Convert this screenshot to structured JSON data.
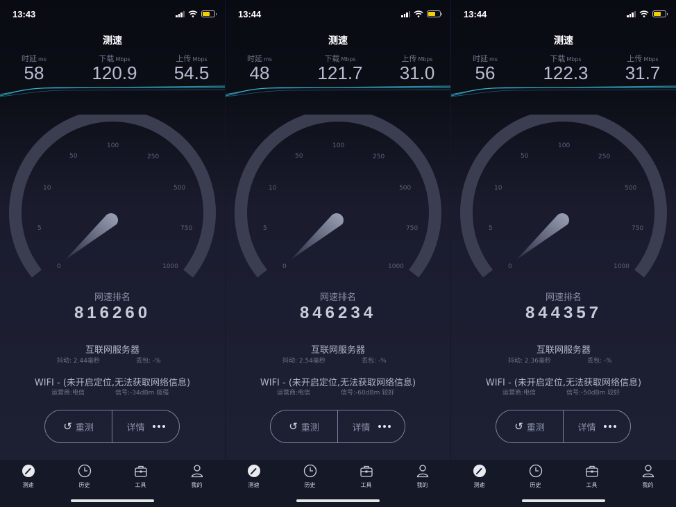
{
  "title": "测速",
  "labels": {
    "ping": "时延",
    "ping_unit": "ms",
    "download": "下载",
    "download_unit": "Mbps",
    "upload": "上传",
    "upload_unit": "Mbps",
    "rank": "网速排名",
    "server": "互联网服务器",
    "jitter": "抖动",
    "loss": "丢包",
    "carrier": "运营商",
    "signal": "信号",
    "wifi": "WIFI",
    "wifi_msg": "(未开启定位,无法获取网络信息)"
  },
  "gauge_ticks": [
    "0",
    "5",
    "10",
    "50",
    "100",
    "250",
    "500",
    "750",
    "1000"
  ],
  "buttons": {
    "retest": "重测",
    "details": "详情"
  },
  "tabs": [
    {
      "label": "测速",
      "icon": "speedometer-icon"
    },
    {
      "label": "历史",
      "icon": "clock-icon"
    },
    {
      "label": "工具",
      "icon": "toolbox-icon"
    },
    {
      "label": "我的",
      "icon": "person-icon"
    }
  ],
  "colors": {
    "accent_wave": "#3ec8d6",
    "battery": "#f5d000"
  },
  "screens": [
    {
      "time": "13:43",
      "ping": "58",
      "download": "120.9",
      "upload": "54.5",
      "rank": "816260",
      "jitter_text": "抖动: 2.44毫秒",
      "loss_text": "丢包: -%",
      "wifi_text": "WIFI - (未开启定位,无法获取网络信息)",
      "carrier_text": "运营商:电信",
      "signal_text": "信号:-34dBm 极强"
    },
    {
      "time": "13:44",
      "ping": "48",
      "download": "121.7",
      "upload": "31.0",
      "rank": "846234",
      "jitter_text": "抖动: 2.54毫秒",
      "loss_text": "丢包: -%",
      "wifi_text": "WIFI - (未开启定位,无法获取网络信息)",
      "carrier_text": "运营商:电信",
      "signal_text": "信号:-60dBm 较好"
    },
    {
      "time": "13:44",
      "ping": "56",
      "download": "122.3",
      "upload": "31.7",
      "rank": "844357",
      "jitter_text": "抖动: 2.36毫秒",
      "loss_text": "丢包: -%",
      "wifi_text": "WIFI - (未开启定位,无法获取网络信息)",
      "carrier_text": "运营商:电信",
      "signal_text": "信号:-50dBm 较好"
    }
  ]
}
